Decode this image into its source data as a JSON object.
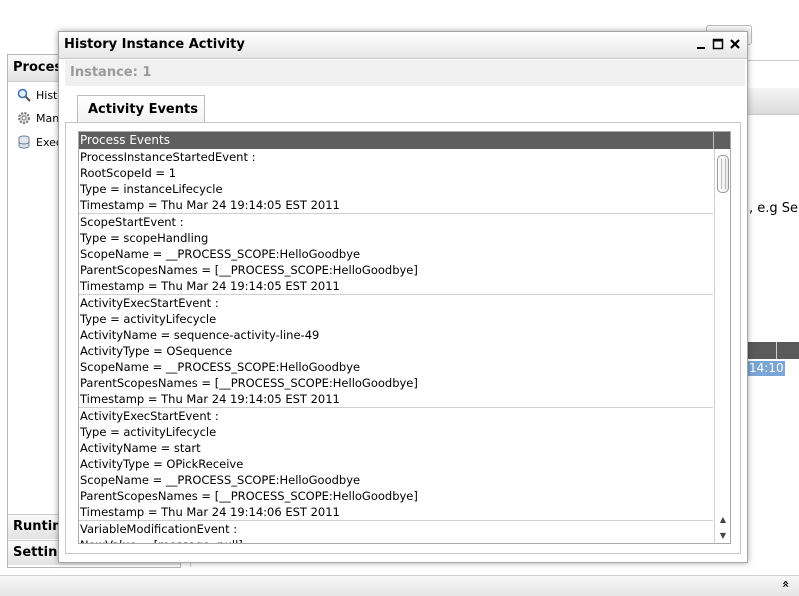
{
  "background": {
    "left_panel": {
      "header": "Proces",
      "items": [
        {
          "label": "Histo",
          "icon": "magnifier-icon"
        },
        {
          "label": "Man",
          "icon": "gear-icon"
        },
        {
          "label": "Exec",
          "icon": "database-icon"
        }
      ],
      "sections": [
        "Runtim",
        "Setting"
      ]
    },
    "right_hint": ", e.g Se",
    "right_cell": "14:10"
  },
  "dialog": {
    "title": "History Instance Activity",
    "controls": {
      "minimize": "—",
      "maximize": "☐",
      "close": "✕"
    },
    "instance_label": "Instance: 1",
    "tab_label": "Activity Events",
    "events_header": "Process Events",
    "events": [
      {
        "lines": [
          "ProcessInstanceStartedEvent :",
          "RootScopeId = 1",
          "Type = instanceLifecycle",
          "Timestamp = Thu Mar 24 19:14:05 EST 2011"
        ]
      },
      {
        "lines": [
          "ScopeStartEvent :",
          "Type = scopeHandling",
          "ScopeName = __PROCESS_SCOPE:HelloGoodbye",
          "ParentScopesNames = [__PROCESS_SCOPE:HelloGoodbye]",
          "Timestamp = Thu Mar 24 19:14:05 EST 2011"
        ]
      },
      {
        "lines": [
          "ActivityExecStartEvent :",
          "Type = activityLifecycle",
          "ActivityName = sequence-activity-line-49",
          "ActivityType = OSequence",
          "ScopeName = __PROCESS_SCOPE:HelloGoodbye",
          "ParentScopesNames = [__PROCESS_SCOPE:HelloGoodbye]",
          "Timestamp = Thu Mar 24 19:14:05 EST 2011"
        ]
      },
      {
        "lines": [
          "ActivityExecStartEvent :",
          "Type = activityLifecycle",
          "ActivityName = start",
          "ActivityType = OPickReceive",
          "ScopeName = __PROCESS_SCOPE:HelloGoodbye",
          "ParentScopesNames = [__PROCESS_SCOPE:HelloGoodbye]",
          "Timestamp = Thu Mar 24 19:14:06 EST 2011"
        ]
      },
      {
        "lines": [
          "VariableModificationEvent :",
          "NewValue = [message: null]"
        ]
      }
    ],
    "scroll_up": "▲",
    "scroll_down": "▼"
  },
  "bottom_bar": {
    "collapse_icon": "«"
  }
}
